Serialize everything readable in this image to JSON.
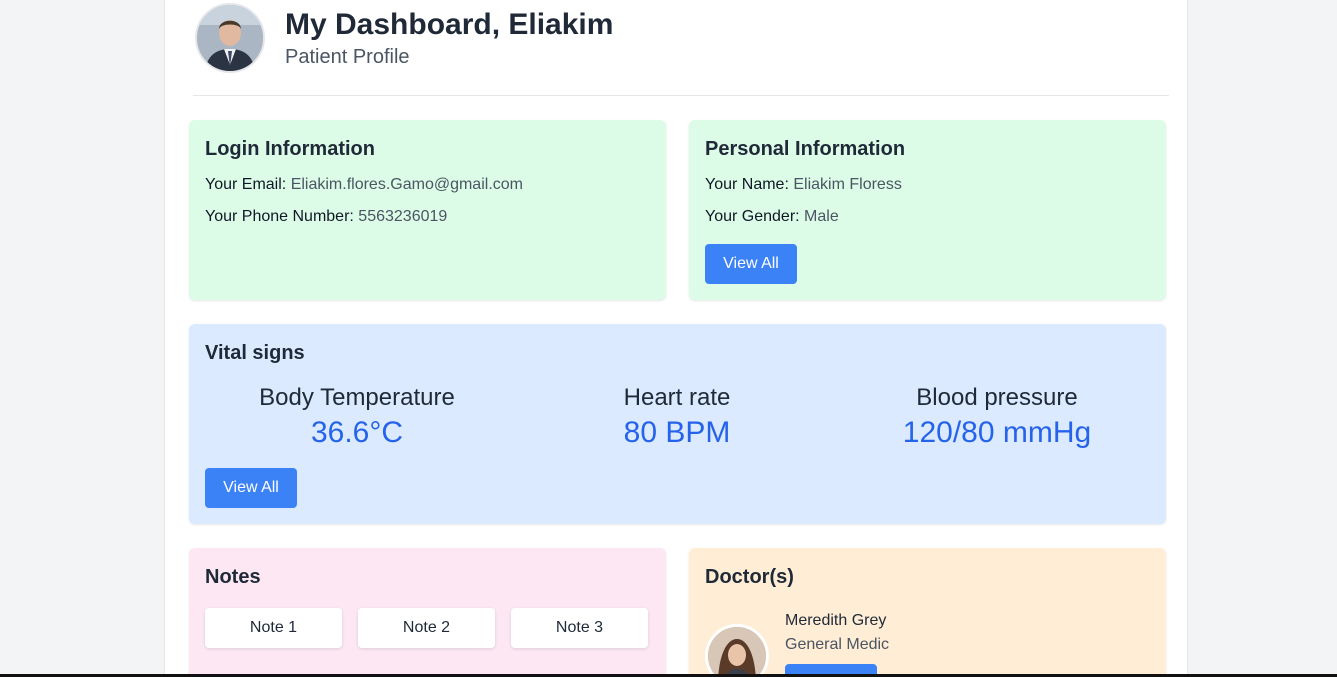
{
  "header": {
    "title": "My Dashboard, Eliakim",
    "subtitle": "Patient Profile",
    "avatar_icon": "user-photo-icon"
  },
  "login_info": {
    "heading": "Login Information",
    "email_label": "Your Email:",
    "email_value": "Eliakim.flores.Gamo@gmail.com",
    "phone_label": "Your Phone Number:",
    "phone_value": "5563236019"
  },
  "personal_info": {
    "heading": "Personal Information",
    "name_label": "Your Name:",
    "name_value": "Eliakim Floress",
    "gender_label": "Your Gender:",
    "gender_value": "Male",
    "button_label": "View All"
  },
  "vitals": {
    "heading": "Vital signs",
    "items": [
      {
        "label": "Body Temperature",
        "value": "36.6°C"
      },
      {
        "label": "Heart rate",
        "value": "80 BPM"
      },
      {
        "label": "Blood pressure",
        "value": "120/80 mmHg"
      }
    ],
    "button_label": "View All"
  },
  "notes": {
    "heading": "Notes",
    "items": [
      "Note 1",
      "Note 2",
      "Note 3"
    ]
  },
  "doctors": {
    "heading": "Doctor(s)",
    "items": [
      {
        "name": "Meredith Grey",
        "specialty": "General Medic",
        "avatar_icon": "doctor-photo-icon"
      }
    ]
  },
  "colors": {
    "primary_button": "#3b82f6",
    "vital_value": "#2563eb",
    "login_card_bg": "#dcfce7",
    "personal_card_bg": "#dcfce7",
    "vitals_card_bg": "#dbeafe",
    "notes_card_bg": "#fce7f3",
    "doctors_card_bg": "#ffedd5"
  }
}
